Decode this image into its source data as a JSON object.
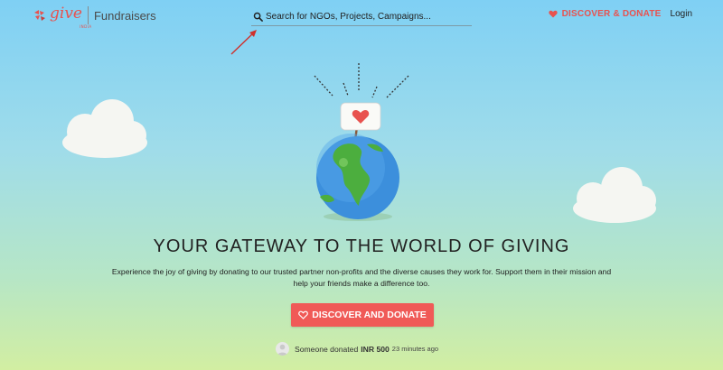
{
  "brand": {
    "logo_text": "give",
    "logo_sub": "INDIA",
    "product": "Fundraisers"
  },
  "search": {
    "placeholder": "Search for NGOs, Projects, Campaigns..."
  },
  "nav": {
    "discover_label": "DISCOVER & DONATE",
    "login_label": "Login"
  },
  "hero": {
    "title": "YOUR GATEWAY TO THE WORLD OF GIVING",
    "description": "Experience the joy of giving by donating to our trusted partner non-profits and the diverse causes they work for. Support them in their mission and help your friends make a difference too.",
    "cta_label": "DISCOVER AND DONATE"
  },
  "activity": {
    "prefix": "Someone donated",
    "amount": "INR 500",
    "time": "23 minutes ago"
  },
  "colors": {
    "accent": "#e8524f",
    "cta": "#f05a57"
  },
  "icons": [
    "brand-logo-icon",
    "search-icon",
    "heart-icon",
    "arrow-annotation",
    "cloud",
    "globe-illustration",
    "avatar-icon"
  ]
}
